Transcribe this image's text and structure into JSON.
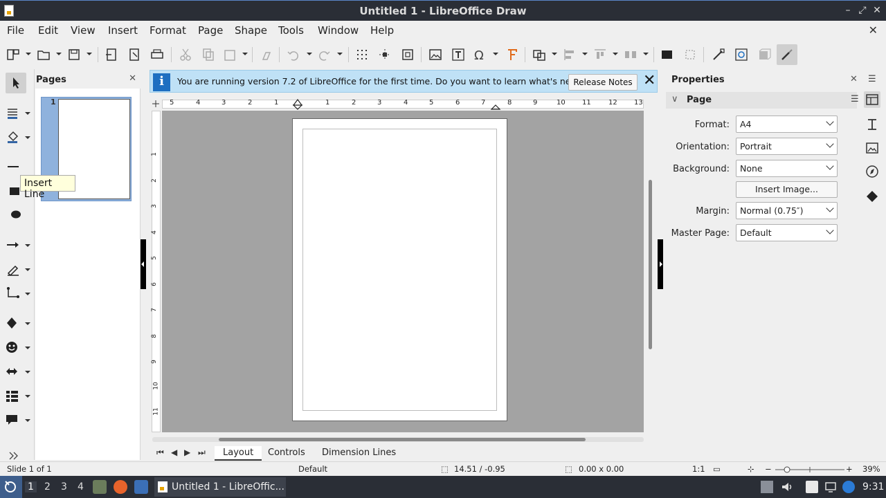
{
  "window": {
    "title": "Untitled 1 - LibreOffice Draw"
  },
  "menu": [
    "File",
    "Edit",
    "View",
    "Insert",
    "Format",
    "Page",
    "Shape",
    "Tools",
    "Window",
    "Help"
  ],
  "infobar": {
    "message": "You are running version 7.2 of LibreOffice for the first time. Do you want to learn what's new?",
    "button": "Release Notes"
  },
  "tooltip": "Insert Line",
  "pages_panel": {
    "title": "Pages",
    "page_number": "1"
  },
  "ruler": {
    "h_labels": [
      "5",
      "4",
      "3",
      "2",
      "1",
      "1",
      "2",
      "3",
      "4",
      "5",
      "6",
      "7",
      "8",
      "9",
      "10",
      "11",
      "12",
      "13"
    ],
    "v_labels": [
      "1",
      "2",
      "3",
      "4",
      "5",
      "6",
      "7",
      "8",
      "9",
      "10",
      "11"
    ]
  },
  "tabs": [
    "Layout",
    "Controls",
    "Dimension Lines"
  ],
  "properties": {
    "title": "Properties",
    "section": "Page",
    "format_label": "Format:",
    "format_value": "A4",
    "orientation_label": "Orientation:",
    "orientation_value": "Portrait",
    "background_label": "Background:",
    "background_value": "None",
    "insert_image": "Insert Image...",
    "margin_label": "Margin:",
    "margin_value": "Normal (0.75″)",
    "master_label": "Master Page:",
    "master_value": "Default"
  },
  "status": {
    "slide": "Slide 1 of 1",
    "layout": "Default",
    "position": "14.51 / -0.95",
    "size": "0.00 x 0.00",
    "scale": "1:1",
    "zoom": "39%"
  },
  "taskbar": {
    "workspaces": [
      "1",
      "2",
      "3",
      "4"
    ],
    "task_title": "Untitled 1 - LibreOffic...",
    "clock": "9:31"
  },
  "colors": {
    "accent": "#1e6fc1",
    "infobar": "#bfe1f6",
    "canvas": "#a3a3a3",
    "titlebar": "#2a2e36"
  }
}
